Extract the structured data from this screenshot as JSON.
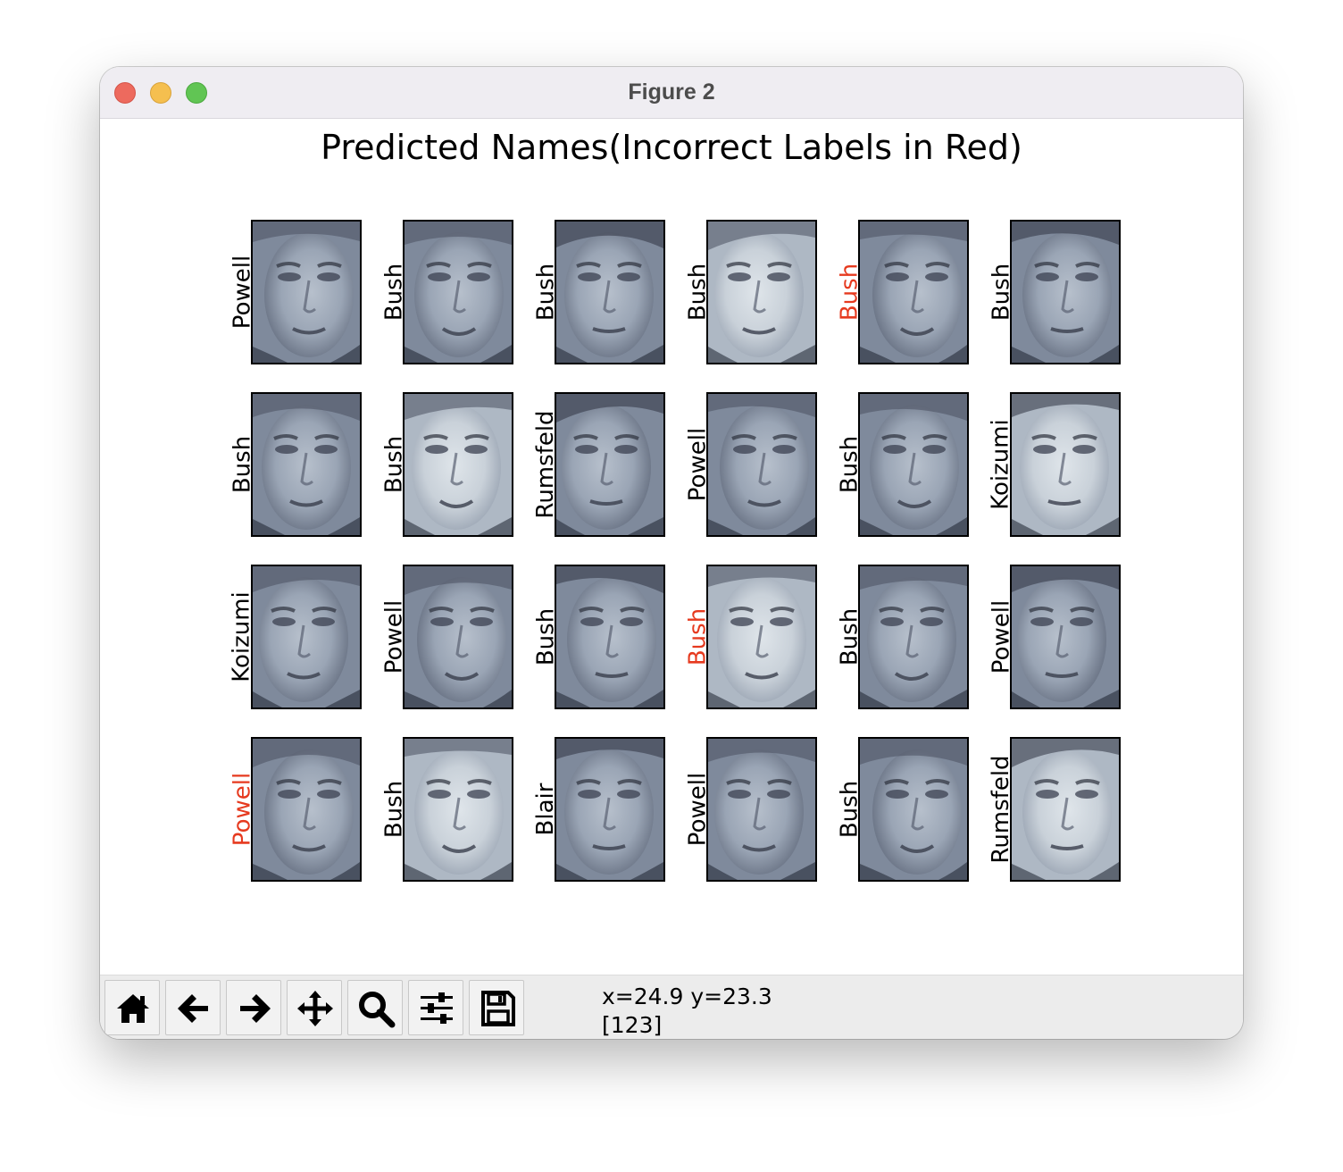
{
  "window": {
    "title": "Figure 2"
  },
  "figure": {
    "title": "Predicted Names(Incorrect Labels in Red)",
    "incorrect_color": "#e63a1f",
    "correct_color": "#000000",
    "rows": [
      [
        {
          "label": "Powell",
          "correct": true
        },
        {
          "label": "Bush",
          "correct": true
        },
        {
          "label": "Bush",
          "correct": true
        },
        {
          "label": "Bush",
          "correct": true
        },
        {
          "label": "Bush",
          "correct": false
        },
        {
          "label": "Bush",
          "correct": true
        }
      ],
      [
        {
          "label": "Bush",
          "correct": true
        },
        {
          "label": "Bush",
          "correct": true
        },
        {
          "label": "Rumsfeld",
          "correct": true
        },
        {
          "label": "Powell",
          "correct": true
        },
        {
          "label": "Bush",
          "correct": true
        },
        {
          "label": "Koizumi",
          "correct": true
        }
      ],
      [
        {
          "label": "Koizumi",
          "correct": true
        },
        {
          "label": "Powell",
          "correct": true
        },
        {
          "label": "Bush",
          "correct": true
        },
        {
          "label": "Bush",
          "correct": false
        },
        {
          "label": "Bush",
          "correct": true
        },
        {
          "label": "Powell",
          "correct": true
        }
      ],
      [
        {
          "label": "Powell",
          "correct": false
        },
        {
          "label": "Bush",
          "correct": true
        },
        {
          "label": "Blair",
          "correct": true
        },
        {
          "label": "Powell",
          "correct": true
        },
        {
          "label": "Bush",
          "correct": true
        },
        {
          "label": "Rumsfeld",
          "correct": true
        }
      ]
    ]
  },
  "toolbar": {
    "buttons": [
      {
        "name": "home",
        "icon": "home-icon"
      },
      {
        "name": "back",
        "icon": "arrow-left-icon"
      },
      {
        "name": "forward",
        "icon": "arrow-right-icon"
      },
      {
        "name": "pan",
        "icon": "move-icon"
      },
      {
        "name": "zoom",
        "icon": "magnifier-icon"
      },
      {
        "name": "configure-subplots",
        "icon": "sliders-icon"
      },
      {
        "name": "save",
        "icon": "floppy-disk-icon"
      }
    ],
    "coordinates": "x=24.9 y=23.3",
    "pixel_value": "[123]"
  }
}
